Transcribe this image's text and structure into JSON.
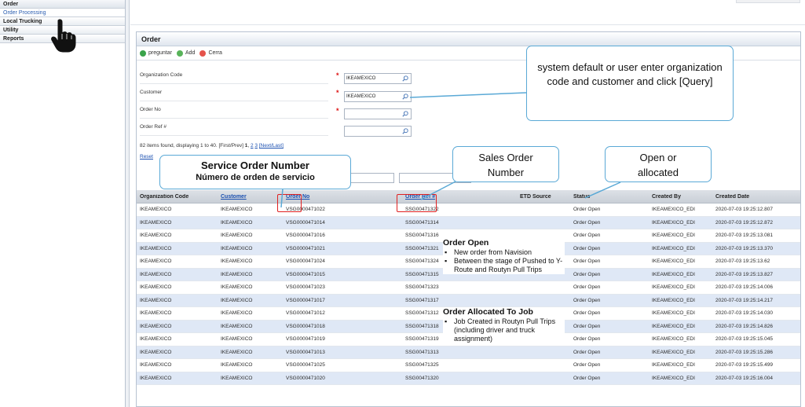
{
  "nav": {
    "items": [
      {
        "label": "Order"
      },
      {
        "label": "Order Processing"
      },
      {
        "label": "Local Trucking"
      },
      {
        "label": "Utility"
      },
      {
        "label": "Reports"
      }
    ]
  },
  "panel": {
    "title": "Order",
    "toolbar": {
      "query": "preguntar",
      "add": "Add",
      "close": "Cerra"
    }
  },
  "form": {
    "org_label": "Organization Code",
    "org_value": "IKEAMEXICO",
    "customer_label": "Customer",
    "customer_value": "IKEAMEXICO",
    "order_no_label": "Order No",
    "order_ref_label": "Order Ref #"
  },
  "paging": {
    "summary": "82 items found, displaying 1 to 40.",
    "nav_prefix": "[First/Prev]",
    "current": "1",
    "sep": ",",
    "p2": "2",
    "p3": "3",
    "next_last": "[Next/Last]",
    "reset": "Reset"
  },
  "table": {
    "headers": [
      "Organization Code",
      "Customer",
      "Order No",
      "Order Ref #",
      "ETD Source",
      "Status",
      "Created By",
      "Created Date"
    ],
    "rows": [
      [
        "IKEAMEXICO",
        "IKEAMEXICO",
        "VSG0000471022",
        "SSG00471322",
        "",
        "Order Open",
        "IKEAMEXICO_EDI",
        "2020-07-03 19:25:12.807"
      ],
      [
        "IKEAMEXICO",
        "IKEAMEXICO",
        "VSG0000471014",
        "SSG00471314",
        "",
        "Order Open",
        "IKEAMEXICO_EDI",
        "2020-07-03 19:25:12.872"
      ],
      [
        "IKEAMEXICO",
        "IKEAMEXICO",
        "VSG0000471016",
        "SSG00471316",
        "",
        "Order Open",
        "IKEAMEXICO_EDI",
        "2020-07-03 19:25:13.081"
      ],
      [
        "IKEAMEXICO",
        "IKEAMEXICO",
        "VSG0000471021",
        "SSG00471321",
        "",
        "Order Open",
        "IKEAMEXICO_EDI",
        "2020-07-03 19:25:13.370"
      ],
      [
        "IKEAMEXICO",
        "IKEAMEXICO",
        "VSG0000471024",
        "SSG00471324",
        "",
        "Order Open",
        "IKEAMEXICO_EDI",
        "2020-07-03 19:25:13.62"
      ],
      [
        "IKEAMEXICO",
        "IKEAMEXICO",
        "VSG0000471015",
        "SSG00471315",
        "",
        "Order Open",
        "IKEAMEXICO_EDI",
        "2020-07-03 19:25:13.827"
      ],
      [
        "IKEAMEXICO",
        "IKEAMEXICO",
        "VSG0000471023",
        "SSG00471323",
        "",
        "Order Open",
        "IKEAMEXICO_EDI",
        "2020-07-03 19:25:14.006"
      ],
      [
        "IKEAMEXICO",
        "IKEAMEXICO",
        "VSG0000471017",
        "SSG00471317",
        "",
        "Order Open",
        "IKEAMEXICO_EDI",
        "2020-07-03 19:25:14.217"
      ],
      [
        "IKEAMEXICO",
        "IKEAMEXICO",
        "VSG0000471012",
        "SSG00471312",
        "",
        "Order Open",
        "IKEAMEXICO_EDI",
        "2020-07-03 19:25:14.030"
      ],
      [
        "IKEAMEXICO",
        "IKEAMEXICO",
        "VSG0000471018",
        "SSG00471318",
        "",
        "Order Open",
        "IKEAMEXICO_EDI",
        "2020-07-03 19:25:14.826"
      ],
      [
        "IKEAMEXICO",
        "IKEAMEXICO",
        "VSG0000471019",
        "SSG00471319",
        "",
        "Order Open",
        "IKEAMEXICO_EDI",
        "2020-07-03 19:25:15.045"
      ],
      [
        "IKEAMEXICO",
        "IKEAMEXICO",
        "VSG0000471013",
        "SSG00471313",
        "",
        "Order Open",
        "IKEAMEXICO_EDI",
        "2020-07-03 19:25:15.286"
      ],
      [
        "IKEAMEXICO",
        "IKEAMEXICO",
        "VSG0000471025",
        "SSG00471325",
        "",
        "Order Open",
        "IKEAMEXICO_EDI",
        "2020-07-03 19:25:15.499"
      ],
      [
        "IKEAMEXICO",
        "IKEAMEXICO",
        "VSG0000471020",
        "SSG00471320",
        "",
        "Order Open",
        "IKEAMEXICO_EDI",
        "2020-07-03 19:25:16.004"
      ]
    ]
  },
  "annotations": {
    "query_note": "system default or user enter organization code and customer and click [Query]",
    "service_order_en": "Service Order Number",
    "service_order_es": "Número de orden de servicio",
    "sales_order": "Sales Order Number",
    "status_note": "Open or allocated",
    "order_open_title": "Order Open",
    "order_open_b1": "New order from Navision",
    "order_open_b2": "Between the stage of Pushed to Y-Route and Routyn Pull Trips",
    "allocated_title": "Order  Allocated To Job",
    "allocated_b1": "Job Created in Routyn Pull Trips (including driver and truck assignment)"
  },
  "colors": {
    "accent_blue": "#5aa9d6",
    "highlight_red": "#e02020",
    "row_stripe": "#dfe8f6",
    "link": "#1a4fb0"
  }
}
